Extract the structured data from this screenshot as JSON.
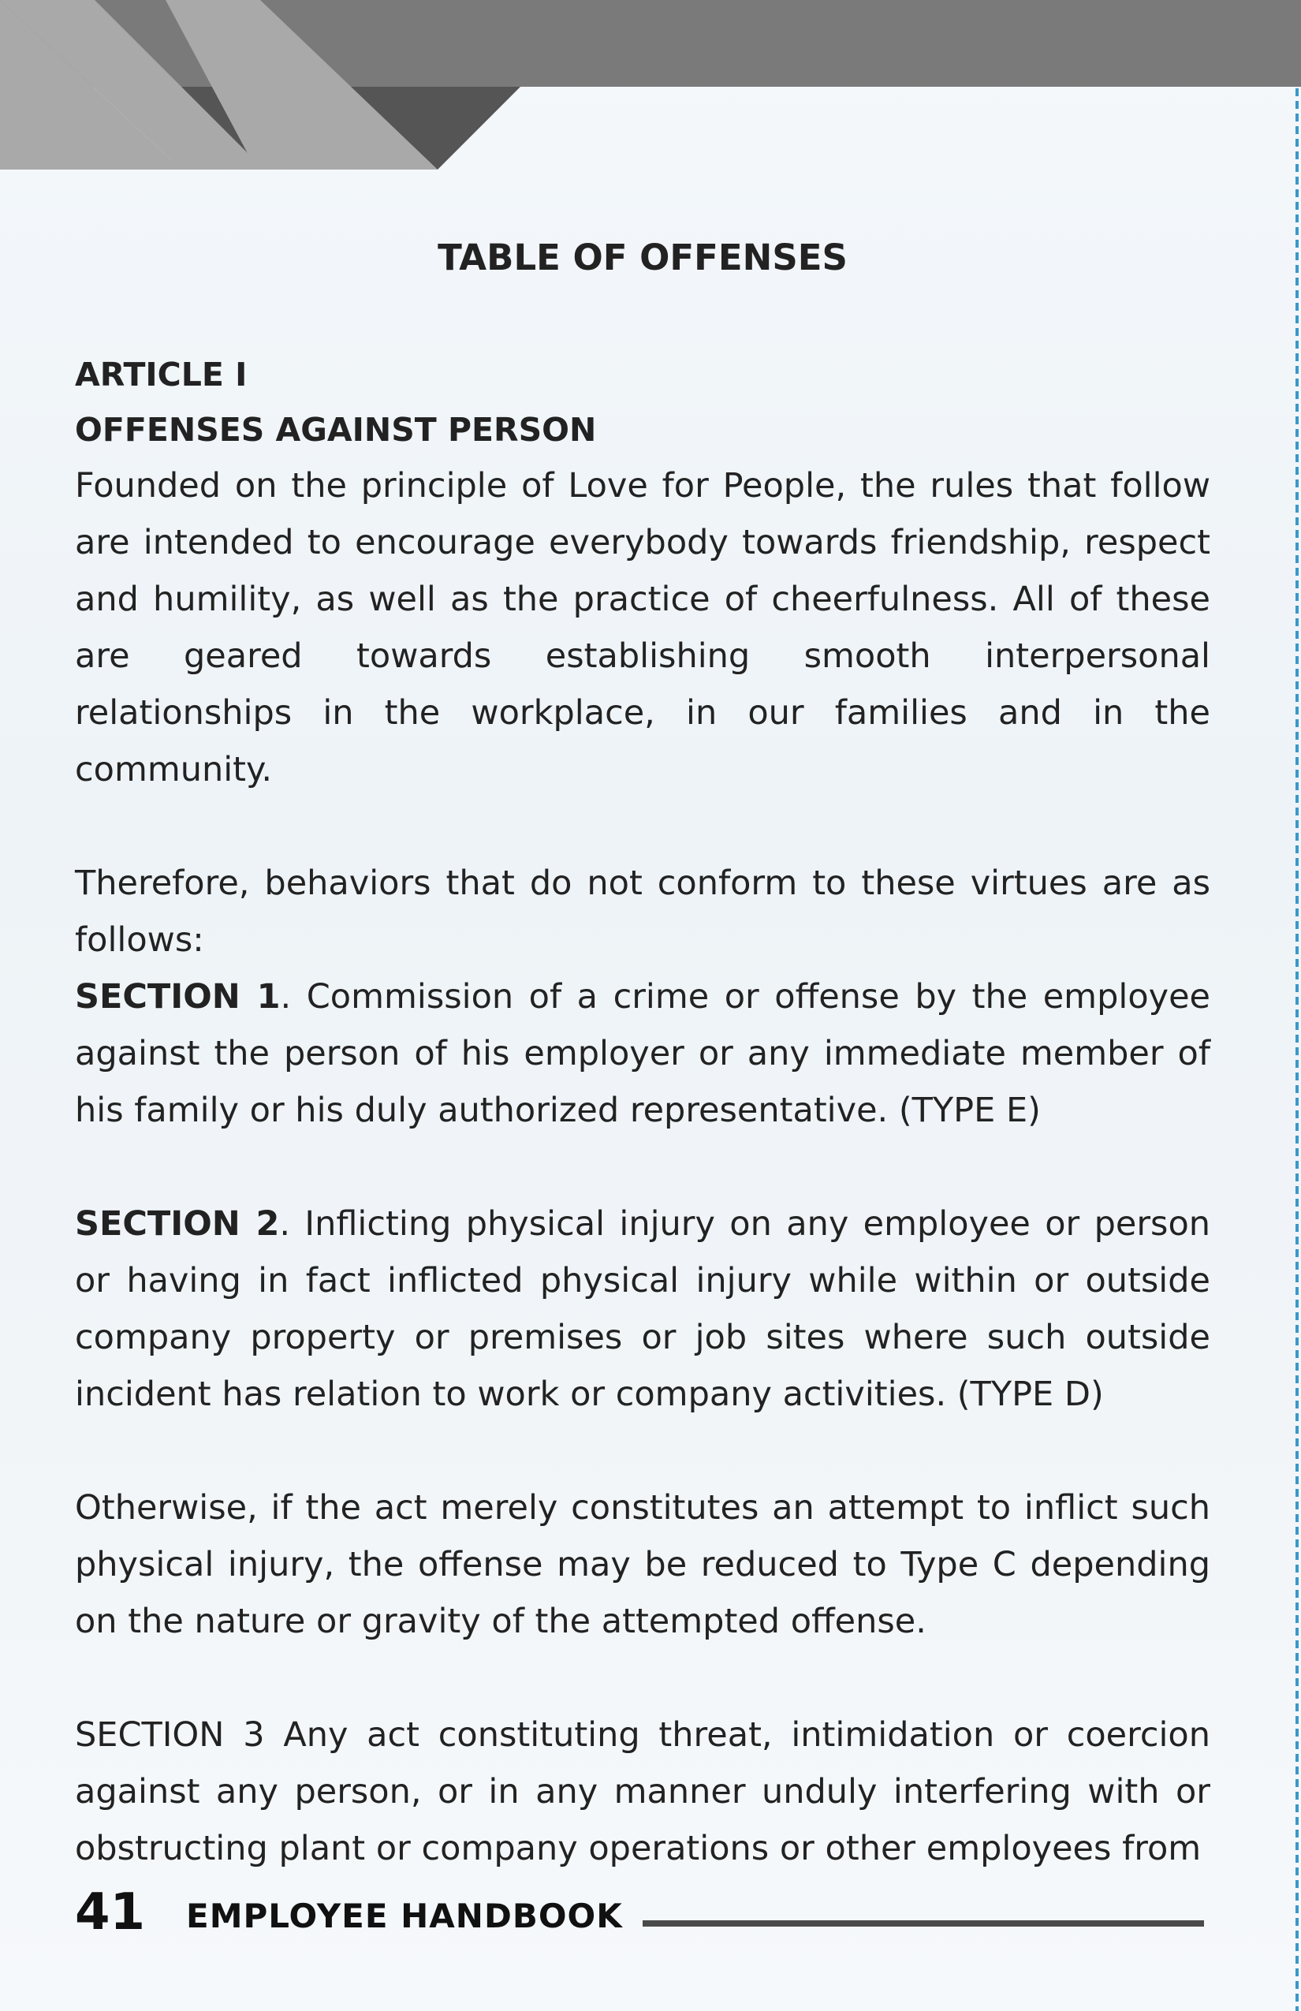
{
  "page": {
    "title": "TABLE OF OFFENSES",
    "article": {
      "label": "ARTICLE I",
      "heading": "OFFENSES AGAINST PERSON"
    },
    "intro": "Founded on the principle of Love for People, the rules that follow are intended to encourage everybody towards friendship, respect and humility, as well as the practice of cheerfulness. All of these are geared towards establishing smooth interpersonal relationships in the workplace, in our families and in the community.",
    "lead_in": "Therefore, behaviors that do not conform to these virtues are as follows:",
    "sections": [
      {
        "label": "SECTION 1",
        "text": ". Commission of a crime or offense by the employee against the person of his employer or any immediate member of his family or his duly authorized representative. (TYPE E)"
      },
      {
        "label": "SECTION 2",
        "text": ". Inflicting physical injury on any employee or person or having in fact inflicted physical injury while within or outside company property or premises or job sites where such outside incident has relation to work or company activities. (TYPE D)"
      }
    ],
    "otherwise": "Otherwise, if the act merely constitutes an attempt to inflict such physical injury, the offense may be reduced to Type C depending on the nature or gravity of the attempted offense.",
    "section3": "SECTION 3 Any act constituting threat, intimidation or coercion against any person, or in any manner unduly interfering with or obstructing plant or company operations or other employees from"
  },
  "footer": {
    "page_number": "41",
    "book_title": "EMPLOYEE HANDBOOK"
  },
  "colors": {
    "header_dark": "#7a7a7a",
    "header_mid": "#555555",
    "header_light": "#a9a9a9",
    "side_rule": "#3a98c9"
  }
}
